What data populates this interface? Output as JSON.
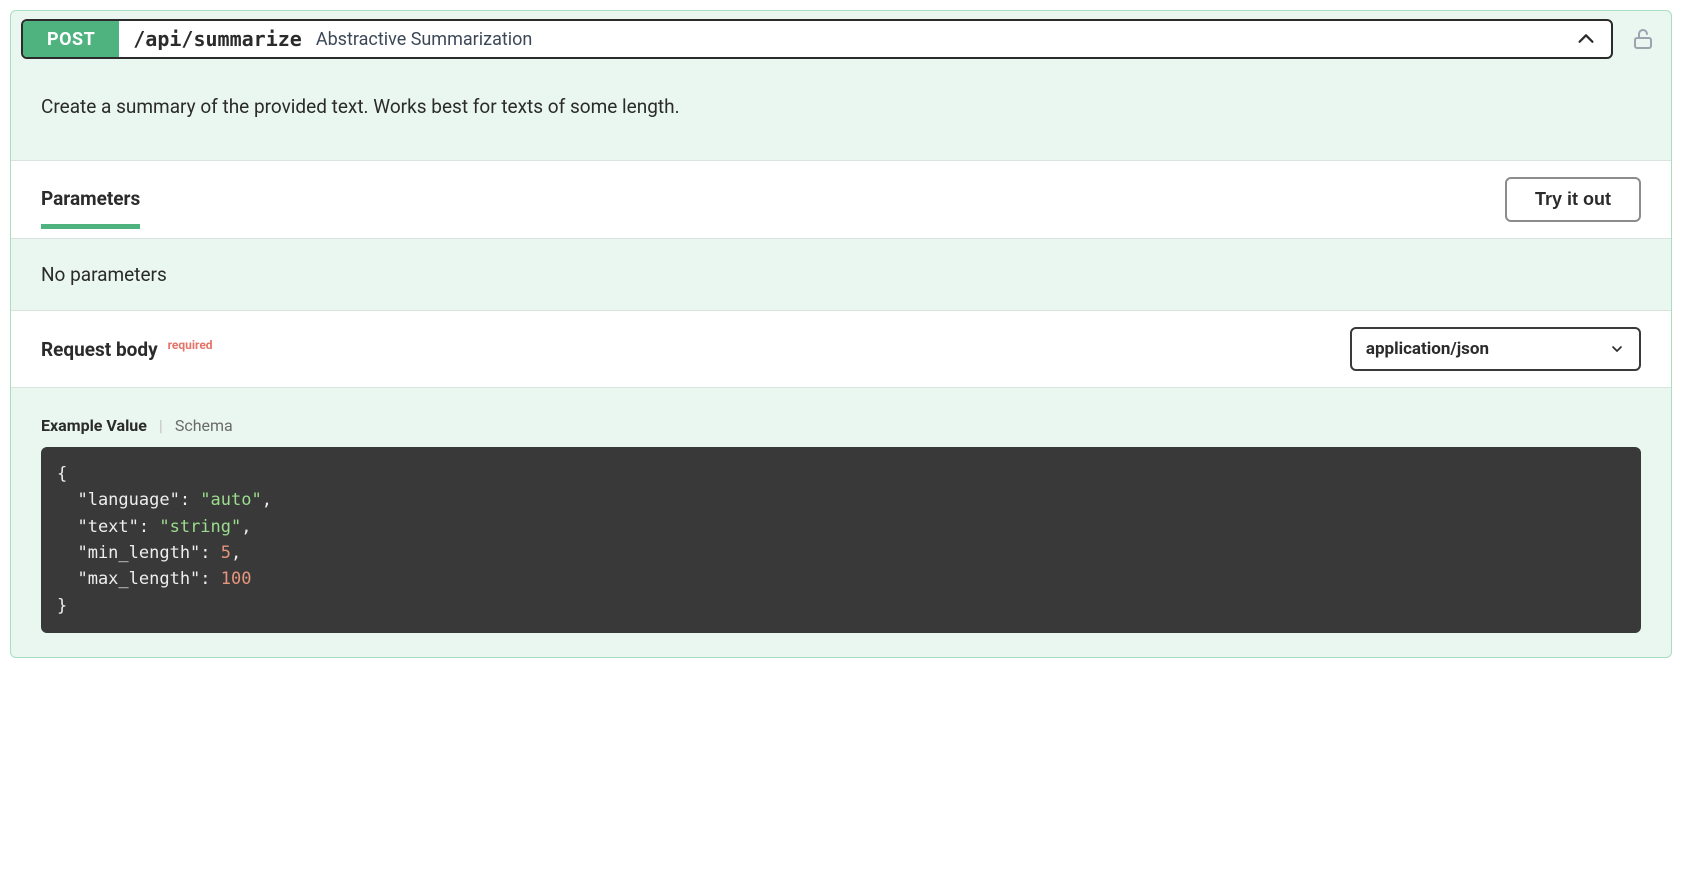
{
  "endpoint": {
    "method": "POST",
    "path": "/api/summarize",
    "summary": "Abstractive Summarization",
    "description": "Create a summary of the provided text. Works best for texts of some length."
  },
  "parameters": {
    "section_label": "Parameters",
    "try_it_label": "Try it out",
    "empty_text": "No parameters"
  },
  "request_body": {
    "section_label": "Request body",
    "required_label": "required",
    "content_type": "application/json",
    "tabs": {
      "example": "Example Value",
      "schema": "Schema"
    },
    "example": {
      "language": "auto",
      "text": "string",
      "min_length": 5,
      "max_length": 100
    }
  }
}
